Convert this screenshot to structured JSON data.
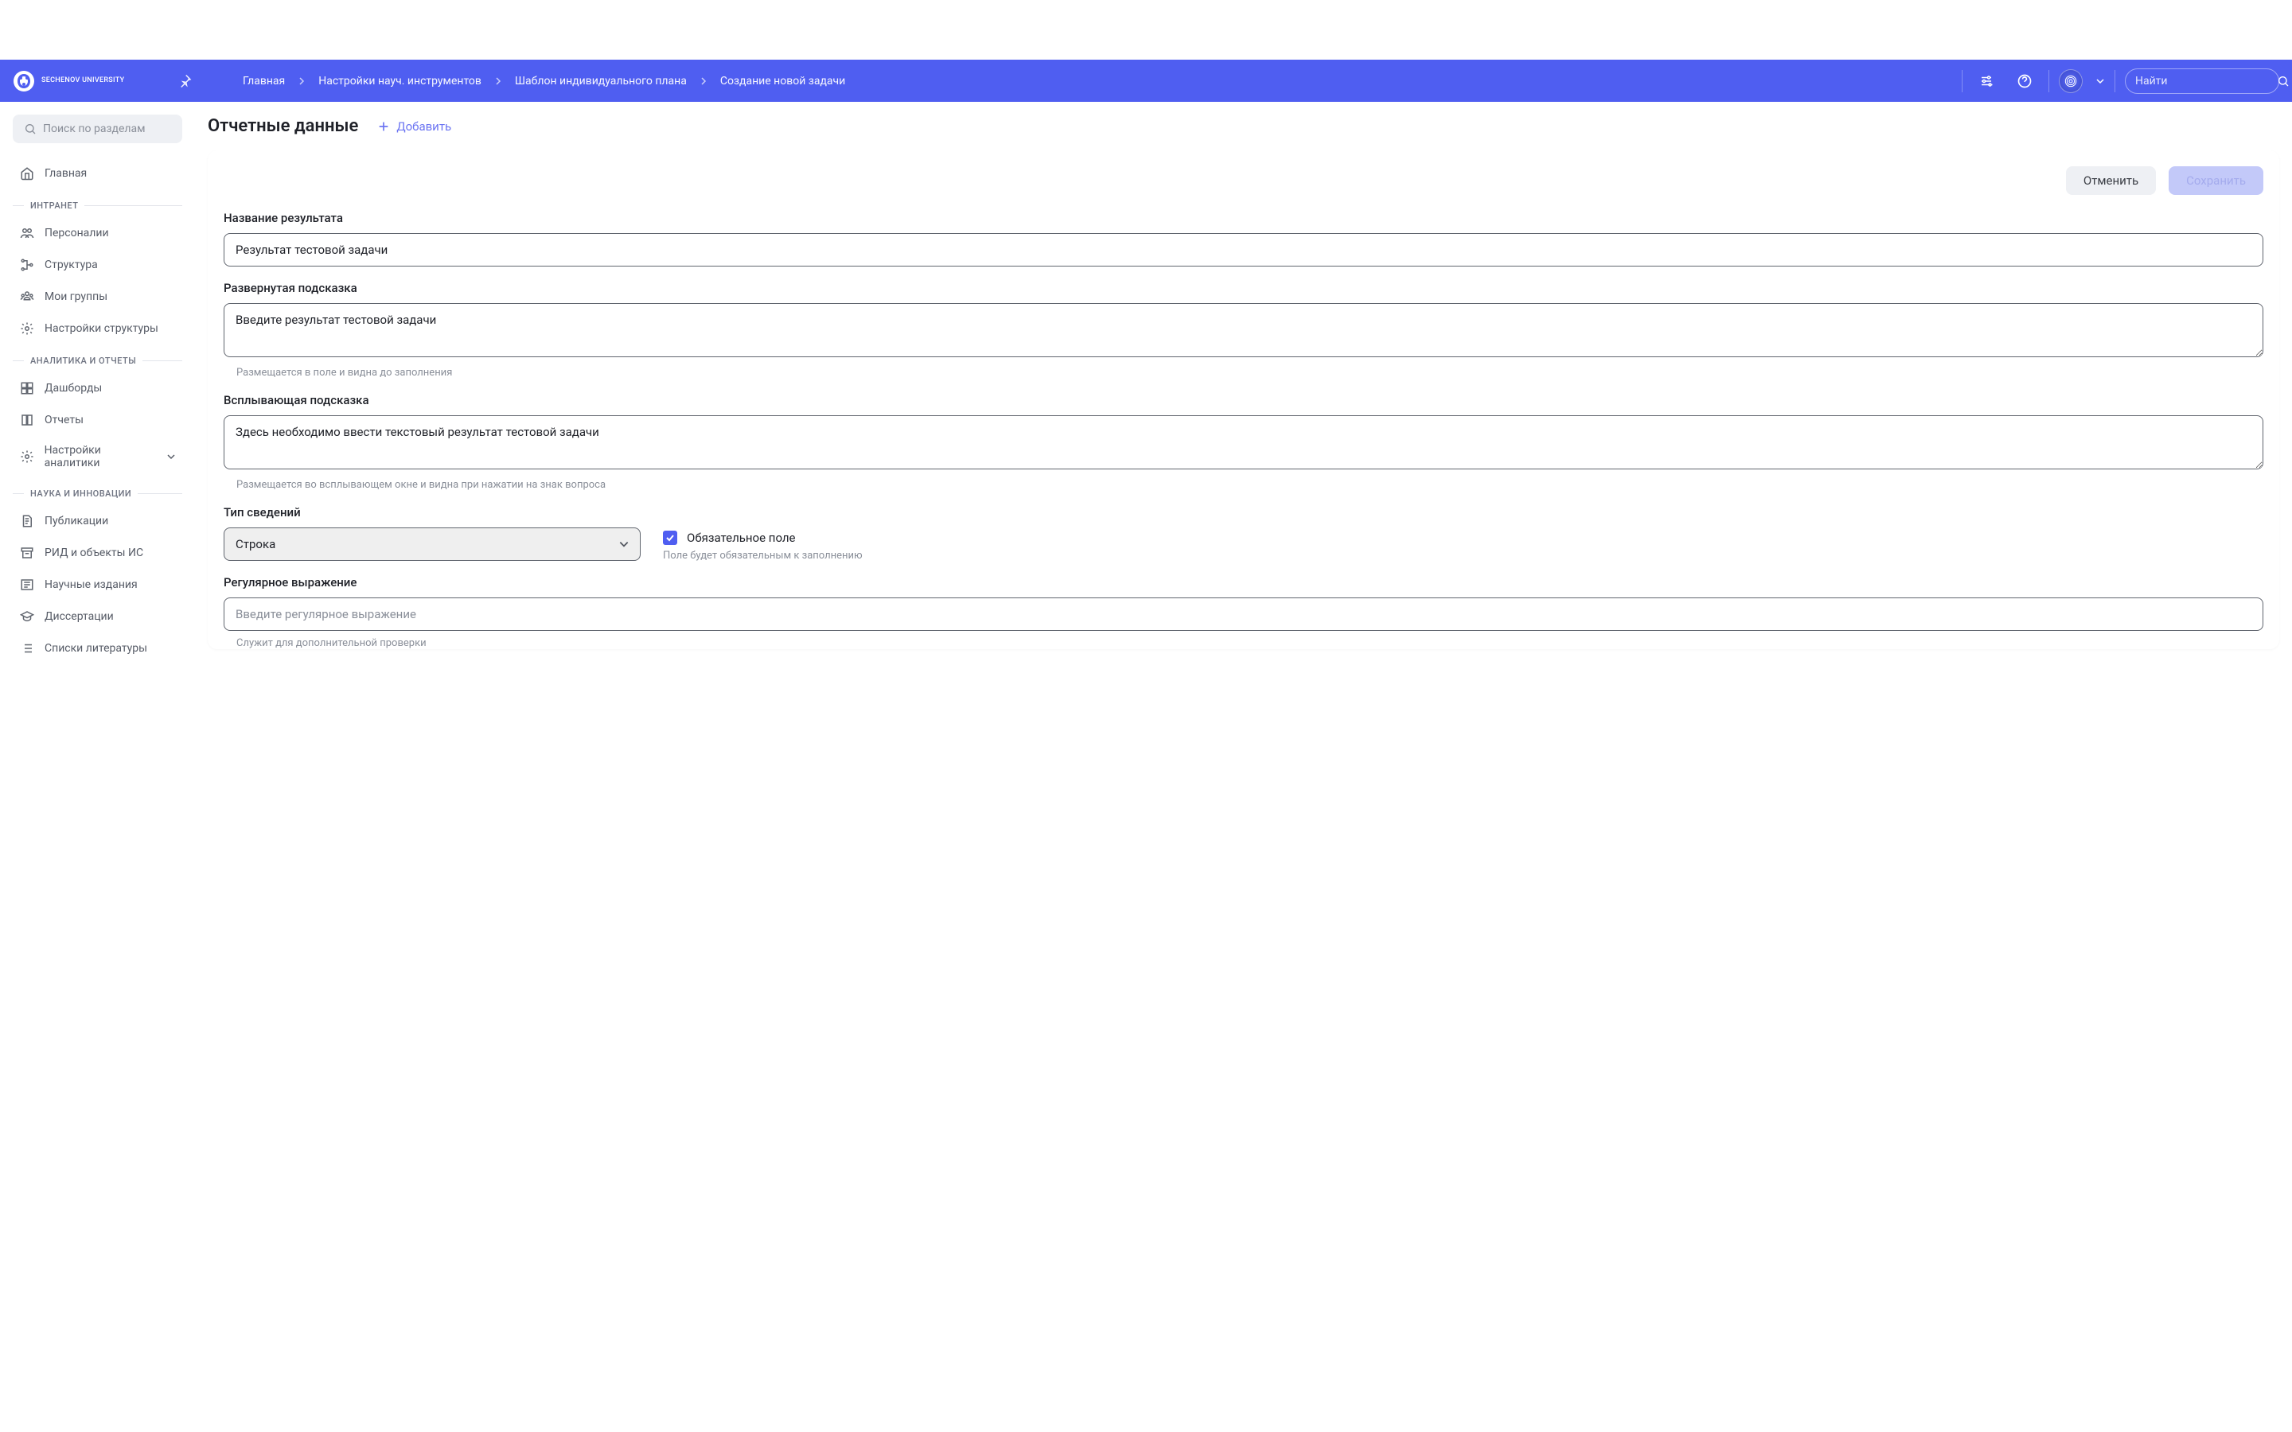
{
  "brand": "SECHENOV UNIVERSITY",
  "breadcrumbs": {
    "items": [
      {
        "label": "Главная"
      },
      {
        "label": "Настройки науч. инструментов"
      },
      {
        "label": "Шаблон индивидуального плана"
      },
      {
        "label": "Создание новой задачи"
      }
    ]
  },
  "topSearch": {
    "placeholder": "Найти"
  },
  "sidebarSearch": {
    "placeholder": "Поиск по разделам"
  },
  "sidebar": {
    "home": "Главная",
    "groups": [
      {
        "title": "ИНТРАНЕТ",
        "items": [
          {
            "label": "Персоналии"
          },
          {
            "label": "Структура"
          },
          {
            "label": "Мои группы"
          },
          {
            "label": "Настройки структуры"
          }
        ]
      },
      {
        "title": "АНАЛИТИКА И ОТЧЕТЫ",
        "items": [
          {
            "label": "Дашборды"
          },
          {
            "label": "Отчеты"
          },
          {
            "label": "Настройки аналитики"
          }
        ]
      },
      {
        "title": "НАУКА И ИННОВАЦИИ",
        "items": [
          {
            "label": "Публикации"
          },
          {
            "label": "РИД и объекты ИС"
          },
          {
            "label": "Научные издания"
          },
          {
            "label": "Диссертации"
          },
          {
            "label": "Списки литературы"
          }
        ]
      }
    ]
  },
  "page": {
    "title": "Отчетные данные",
    "addLabel": "Добавить"
  },
  "actions": {
    "cancel": "Отменить",
    "save": "Сохранить"
  },
  "form": {
    "resultName": {
      "label": "Название результата",
      "value": "Результат тестовой задачи"
    },
    "expandedHint": {
      "label": "Развернутая подсказка",
      "value": "Введите результат тестовой задачи",
      "hint": "Размещается в поле и видна до заполнения"
    },
    "popupHint": {
      "label": "Всплывающая подсказка",
      "value": "Здесь необходимо ввести текстовый результат тестовой задачи",
      "hint": "Размещается во всплывающем окне и видна при нажатии на знак вопроса"
    },
    "dataType": {
      "label": "Тип сведений",
      "value": "Строка"
    },
    "required": {
      "label": "Обязательное поле",
      "hint": "Поле будет обязательным к заполнению"
    },
    "regex": {
      "label": "Регулярное выражение",
      "placeholder": "Введите регулярное выражение",
      "hint": "Служит для дополнительной проверки"
    }
  }
}
